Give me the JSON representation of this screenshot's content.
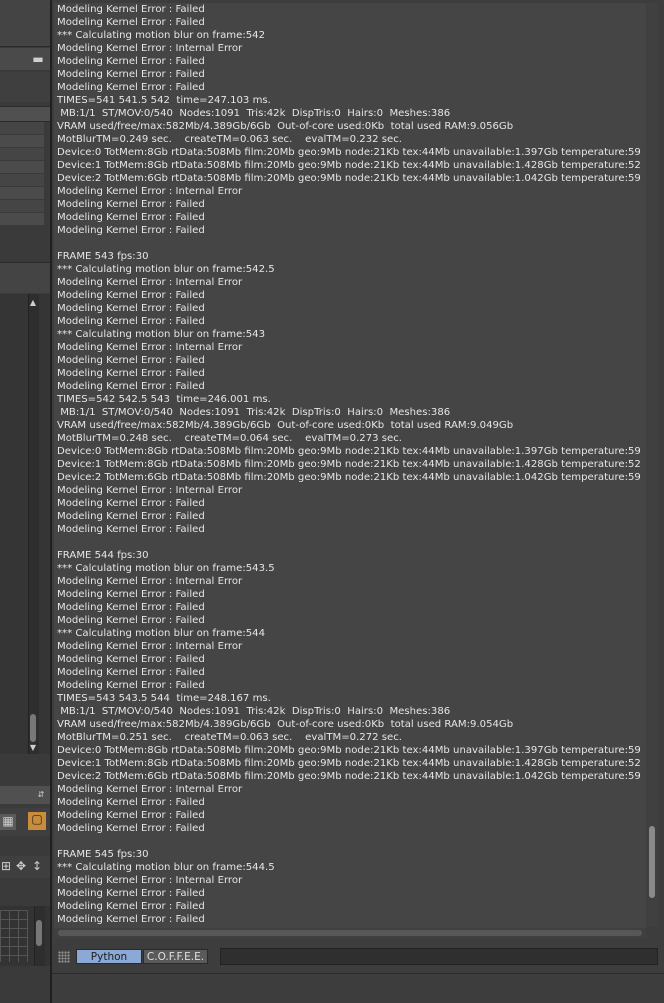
{
  "console": {
    "lines": [
      "Modeling Kernel Error : Failed",
      "Modeling Kernel Error : Failed",
      "*** Calculating motion blur on frame:542",
      "Modeling Kernel Error : Internal Error",
      "Modeling Kernel Error : Failed",
      "Modeling Kernel Error : Failed",
      "Modeling Kernel Error : Failed",
      "TIMES=541 541.5 542  time=247.103 ms.",
      " MB:1/1  ST/MOV:0/540  Nodes:1091  Tris:42k  DispTris:0  Hairs:0  Meshes:386",
      "VRAM used/free/max:582Mb/4.389Gb/6Gb  Out-of-core used:0Kb  total used RAM:9.056Gb",
      "MotBlurTM=0.249 sec.    createTM=0.063 sec.    evalTM=0.232 sec.",
      "Device:0 TotMem:8Gb rtData:508Mb film:20Mb geo:9Mb node:21Kb tex:44Mb unavailable:1.397Gb temperature:59",
      "Device:1 TotMem:8Gb rtData:508Mb film:20Mb geo:9Mb node:21Kb tex:44Mb unavailable:1.428Gb temperature:52",
      "Device:2 TotMem:6Gb rtData:508Mb film:20Mb geo:9Mb node:21Kb tex:44Mb unavailable:1.042Gb temperature:59",
      "Modeling Kernel Error : Internal Error",
      "Modeling Kernel Error : Failed",
      "Modeling Kernel Error : Failed",
      "Modeling Kernel Error : Failed",
      "",
      "FRAME 543 fps:30",
      "*** Calculating motion blur on frame:542.5",
      "Modeling Kernel Error : Internal Error",
      "Modeling Kernel Error : Failed",
      "Modeling Kernel Error : Failed",
      "Modeling Kernel Error : Failed",
      "*** Calculating motion blur on frame:543",
      "Modeling Kernel Error : Internal Error",
      "Modeling Kernel Error : Failed",
      "Modeling Kernel Error : Failed",
      "Modeling Kernel Error : Failed",
      "TIMES=542 542.5 543  time=246.001 ms.",
      " MB:1/1  ST/MOV:0/540  Nodes:1091  Tris:42k  DispTris:0  Hairs:0  Meshes:386",
      "VRAM used/free/max:582Mb/4.389Gb/6Gb  Out-of-core used:0Kb  total used RAM:9.049Gb",
      "MotBlurTM=0.248 sec.    createTM=0.064 sec.    evalTM=0.273 sec.",
      "Device:0 TotMem:8Gb rtData:508Mb film:20Mb geo:9Mb node:21Kb tex:44Mb unavailable:1.397Gb temperature:59",
      "Device:1 TotMem:8Gb rtData:508Mb film:20Mb geo:9Mb node:21Kb tex:44Mb unavailable:1.428Gb temperature:52",
      "Device:2 TotMem:6Gb rtData:508Mb film:20Mb geo:9Mb node:21Kb tex:44Mb unavailable:1.042Gb temperature:59",
      "Modeling Kernel Error : Internal Error",
      "Modeling Kernel Error : Failed",
      "Modeling Kernel Error : Failed",
      "Modeling Kernel Error : Failed",
      "",
      "FRAME 544 fps:30",
      "*** Calculating motion blur on frame:543.5",
      "Modeling Kernel Error : Internal Error",
      "Modeling Kernel Error : Failed",
      "Modeling Kernel Error : Failed",
      "Modeling Kernel Error : Failed",
      "*** Calculating motion blur on frame:544",
      "Modeling Kernel Error : Internal Error",
      "Modeling Kernel Error : Failed",
      "Modeling Kernel Error : Failed",
      "Modeling Kernel Error : Failed",
      "TIMES=543 543.5 544  time=248.167 ms.",
      " MB:1/1  ST/MOV:0/540  Nodes:1091  Tris:42k  DispTris:0  Hairs:0  Meshes:386",
      "VRAM used/free/max:582Mb/4.389Gb/6Gb  Out-of-core used:0Kb  total used RAM:9.054Gb",
      "MotBlurTM=0.251 sec.    createTM=0.063 sec.    evalTM=0.272 sec.",
      "Device:0 TotMem:8Gb rtData:508Mb film:20Mb geo:9Mb node:21Kb tex:44Mb unavailable:1.397Gb temperature:59",
      "Device:1 TotMem:8Gb rtData:508Mb film:20Mb geo:9Mb node:21Kb tex:44Mb unavailable:1.428Gb temperature:52",
      "Device:2 TotMem:6Gb rtData:508Mb film:20Mb geo:9Mb node:21Kb tex:44Mb unavailable:1.042Gb temperature:59",
      "Modeling Kernel Error : Internal Error",
      "Modeling Kernel Error : Failed",
      "Modeling Kernel Error : Failed",
      "Modeling Kernel Error : Failed",
      "",
      "FRAME 545 fps:30",
      "*** Calculating motion blur on frame:544.5",
      "Modeling Kernel Error : Internal Error",
      "Modeling Kernel Error : Failed",
      "Modeling Kernel Error : Failed",
      "Modeling Kernel Error : Failed"
    ],
    "scroll_position": 0.97
  },
  "bottom_bar": {
    "grip_icon": "grip-icon",
    "tabs": [
      {
        "label": "Python",
        "active": true
      },
      {
        "label": "C.O.F.F.E.E.",
        "active": false
      }
    ],
    "command_value": ""
  },
  "colors": {
    "console_bg": "#454545",
    "console_text": "#e6e6e6",
    "active_tab": "#8ba8d6"
  }
}
